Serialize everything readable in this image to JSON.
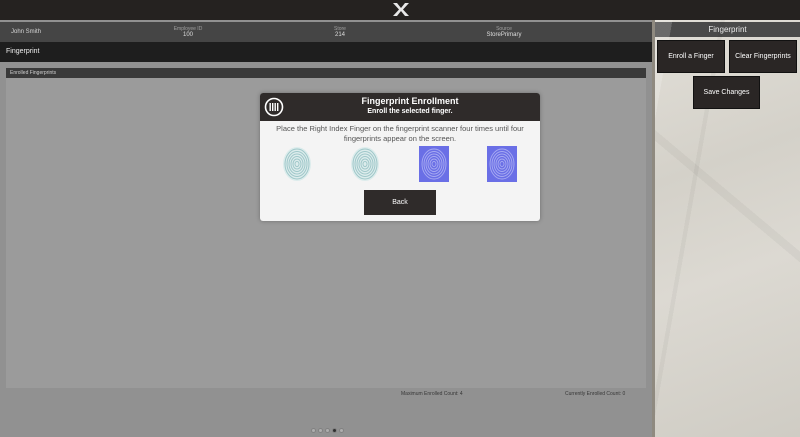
{
  "customer": {
    "name": "John Smith",
    "employee_id_label": "Employee ID",
    "employee_id": "100",
    "store_label": "Store",
    "store": "214",
    "source_label": "Source",
    "source": "StorePrimary"
  },
  "page": {
    "title": "Fingerprint",
    "enrolled_header": "Enrolled Fingerprints",
    "max_count": "Maximum Enrolled Count: 4",
    "current_count": "Currently Enrolled Count: 0"
  },
  "sidebar": {
    "title": "Fingerprint",
    "enroll_label": "Enroll a Finger",
    "clear_label": "Clear Fingerprints",
    "save_label": "Save Changes"
  },
  "modal": {
    "title": "Fingerprint Enrollment",
    "subtitle": "Enroll the selected finger.",
    "message": "Place the Right Index Finger on the fingerprint scanner four times until four fingerprints appear on the screen.",
    "back_label": "Back",
    "icon": "fingerprint-reader-icon"
  },
  "fingerprints": [
    {
      "state": "pending",
      "color": "#9fc7c9"
    },
    {
      "state": "pending",
      "color": "#9fc7c9"
    },
    {
      "state": "captured",
      "color": "#6a6fe6"
    },
    {
      "state": "captured",
      "color": "#6a6fe6"
    }
  ],
  "pager": {
    "count": 5,
    "active_index": 3
  }
}
